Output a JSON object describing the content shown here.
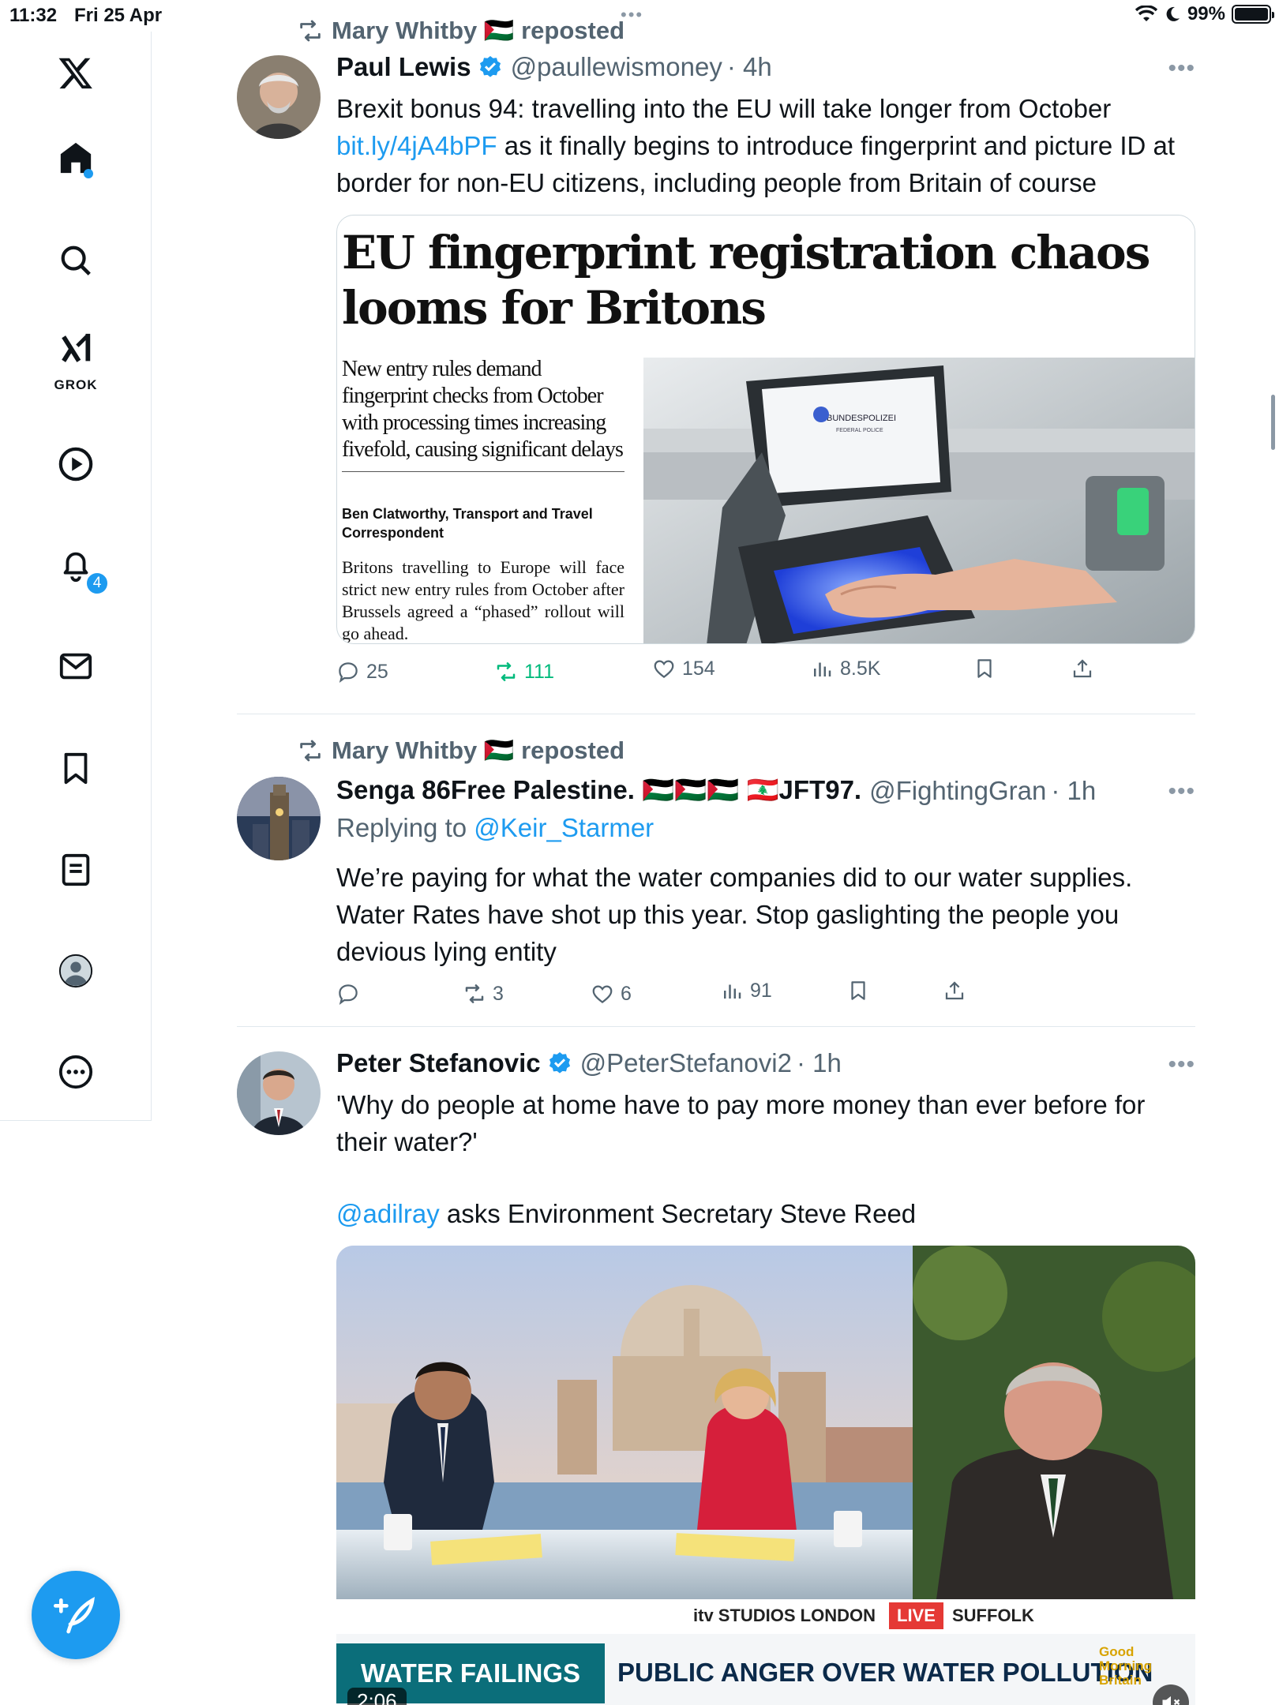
{
  "status_bar": {
    "time": "11:32",
    "date": "Fri 25 Apr",
    "battery": "99%"
  },
  "sidebar": {
    "grok_label": "GROK",
    "notifications_count": "4"
  },
  "colors": {
    "accent": "#1d9bf0",
    "retweet_green": "#00ba7c",
    "secondary_text": "#536471"
  },
  "tweets": [
    {
      "repost_by": "Mary Whitby 🇵🇸 reposted",
      "author": "Paul Lewis",
      "handle": "@paullewismoney",
      "time": "· 4h",
      "text_before_link": "Brexit bonus 94: travelling into the EU will take longer from October ",
      "link": "bit.ly/4jA4bPF",
      "text_after_link": " as it finally begins to introduce fingerprint and picture ID at border for non-EU citizens, including people from Britain of course",
      "card": {
        "headline": "EU fingerprint registration chaos looms for Britons",
        "standfirst": "New entry rules demand fingerprint checks from October with processing times increasing fivefold, causing significant delays",
        "byline": "Ben Clatworthy, Transport and Travel Correspondent",
        "body": "Britons travelling to Europe will face strict new entry rules from October after Brussels agreed a “phased” rollout will go ahead.",
        "sign_text": "BUNDESPOLIZEI",
        "sign_sub": "FEDERAL POLICE"
      },
      "stats": {
        "replies": "25",
        "retweets": "111",
        "likes": "154",
        "views": "8.5K"
      }
    },
    {
      "repost_by": "Mary Whitby 🇵🇸 reposted",
      "author": "Senga 86Free Palestine. 🇵🇸🇵🇸🇵🇸 🇱🇧JFT97.",
      "handle": "@FightingGran",
      "time": "· 1h",
      "replying_label": "Replying to",
      "replying_to": "@Keir_Starmer",
      "text": "We’re paying for what the water companies did to our water supplies. Water Rates have shot up this year. Stop gaslighting the people you devious lying entity",
      "stats": {
        "replies": "",
        "retweets": "3",
        "likes": "6",
        "views": "91"
      }
    },
    {
      "author": "Peter Stefanovic",
      "handle": "@PeterStefanovi2",
      "time": "· 1h",
      "text": "'Why do people at home have to pay more money than ever before for their water?'",
      "mention": "@adilray",
      "text_after_mention": " asks Environment Secretary Steve Reed",
      "video": {
        "studio": "itv STUDIOS LONDON",
        "live": "LIVE",
        "location": "SUFFOLK",
        "ticker_tag": "WATER FAILINGS",
        "ticker_headline": "PUBLIC ANGER OVER WATER POLLUTION",
        "show_logo": "Good Morning Britain",
        "duration": "2:06"
      }
    }
  ]
}
